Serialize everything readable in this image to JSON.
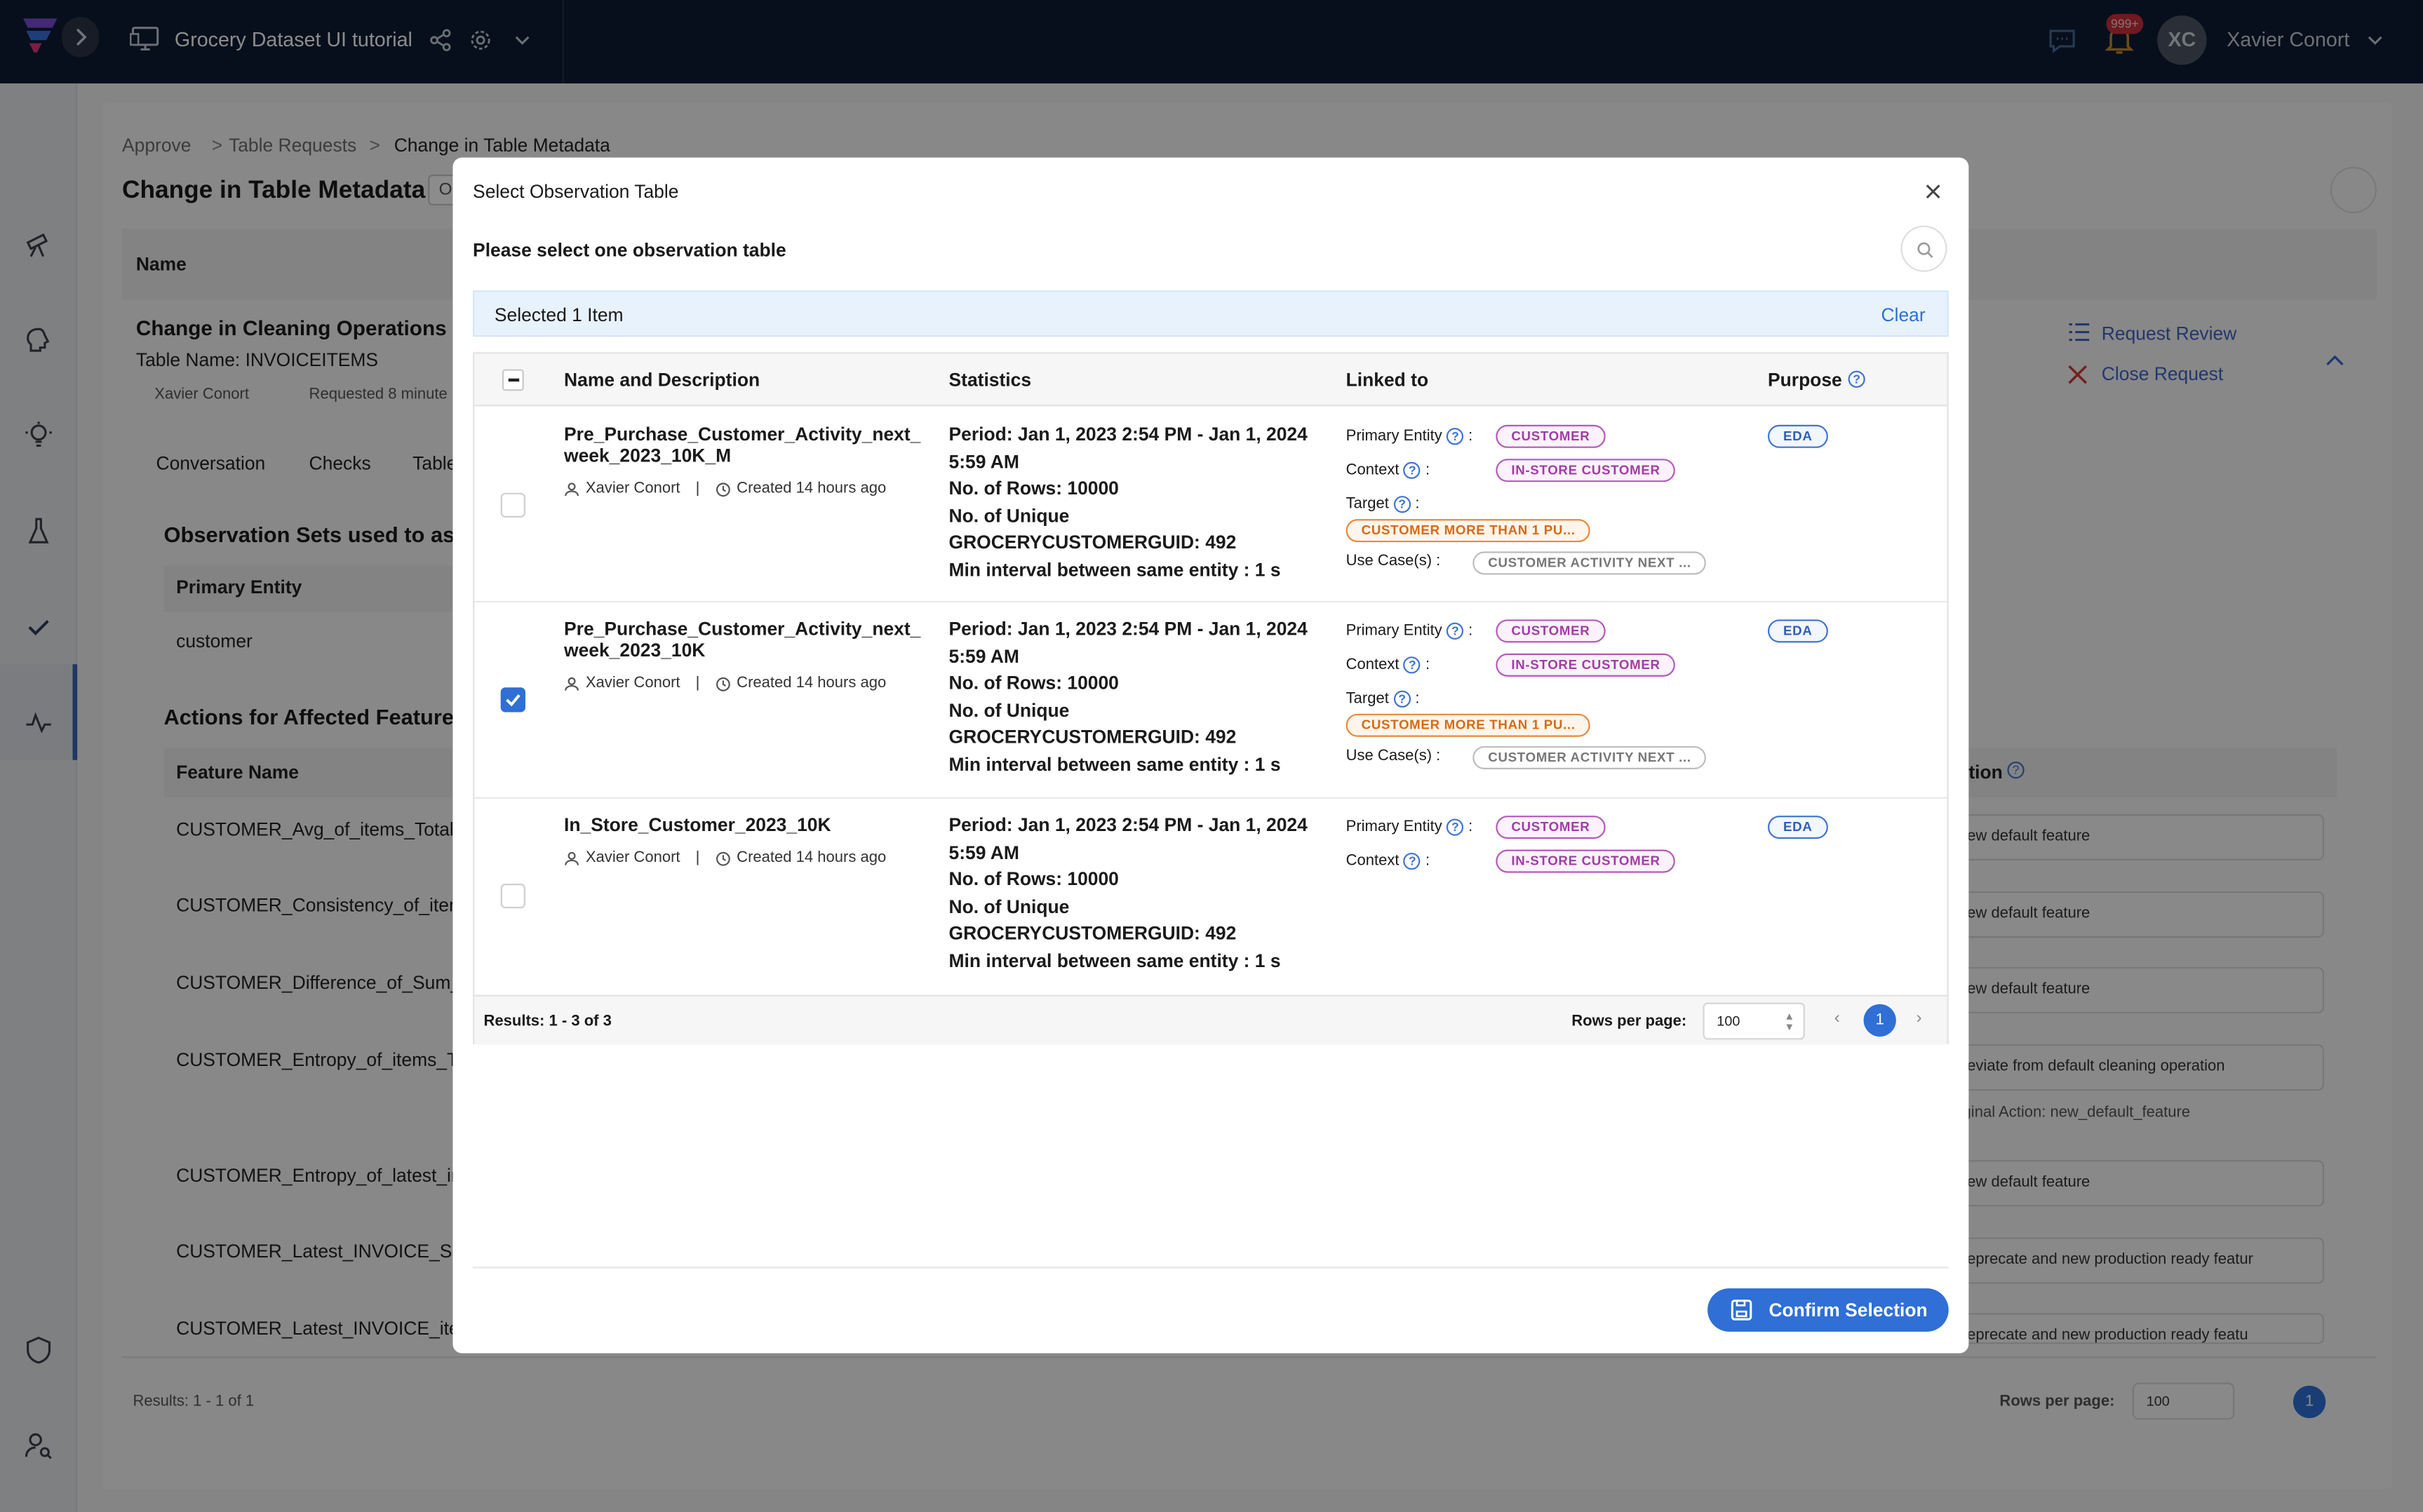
{
  "app": {
    "project_title": "Grocery Dataset UI tutorial",
    "notification_count": "999+",
    "user_initials": "XC",
    "user_name": "Xavier Conort"
  },
  "breadcrumb": [
    "Approve",
    ">",
    "Table Requests",
    ">",
    "Change in Table Metadata"
  ],
  "page": {
    "title": "Change in Table Metadata",
    "title_tag": "Op",
    "name_header": "Name",
    "request_title": "Change in Cleaning Operations o",
    "table_name": "Table Name: INVOICEITEMS",
    "requester": "Xavier Conort",
    "requested": "Requested 8 minute",
    "request_review": "Request Review",
    "close_request": "Close Request",
    "tabs": [
      "Conversation",
      "Checks",
      "Table"
    ],
    "obs_sets_heading": "Observation Sets used to asse",
    "primary_entity_header": "Primary Entity",
    "primary_entity_value": "customer",
    "actions_heading": "Actions for Affected Features:",
    "feature_name_header": "Feature Name",
    "action_header": "tion",
    "features": [
      "CUSTOMER_Avg_of_items_TotalC",
      "CUSTOMER_Consistency_of_item",
      "CUSTOMER_Difference_of_Sum_",
      "CUSTOMER_Entropy_of_items_To",
      "CUSTOMER_Entropy_of_latest_in",
      "CUSTOMER_Latest_INVOICE_Sun",
      "CUSTOMER_Latest_INVOICE_iten"
    ],
    "actions": [
      "ew default feature",
      "ew default feature",
      "ew default feature",
      "eviate from default cleaning operation",
      "ew default feature",
      "eprecate and new production ready featur",
      "eprecate and new production ready featu"
    ],
    "original_action": "ginal Action: new_default_feature",
    "results": "Results: 1 - 1 of 1",
    "rows_per_page_label": "Rows per page:",
    "rows_per_page": "100",
    "page": "1"
  },
  "modal": {
    "title": "Select Observation Table",
    "subtitle": "Please select one observation table",
    "selected_text": "Selected 1 Item",
    "clear_label": "Clear",
    "columns": [
      "Name and Description",
      "Statistics",
      "Linked to",
      "Purpose"
    ],
    "rows": [
      {
        "name": "Pre_Purchase_Customer_Activity_next_week_2023_10K_M",
        "author": "Xavier Conort",
        "created": "Created 14 hours ago",
        "checked": false,
        "stats": [
          "Period: Jan 1, 2023 2:54 PM - Jan 1, 2024 5:59 AM",
          "No. of Rows: 10000",
          "No. of Unique GROCERYCUSTOMERGUID: 492",
          "Min interval between same entity : 1 s"
        ],
        "primary_entity": "CUSTOMER",
        "context": "IN-STORE CUSTOMER",
        "target": "CUSTOMER MORE THAN 1 PU...",
        "use_case": "CUSTOMER ACTIVITY NEXT ...",
        "purpose": "EDA"
      },
      {
        "name": "Pre_Purchase_Customer_Activity_next_week_2023_10K",
        "author": "Xavier Conort",
        "created": "Created 14 hours ago",
        "checked": true,
        "stats": [
          "Period: Jan 1, 2023 2:54 PM - Jan 1, 2024 5:59 AM",
          "No. of Rows: 10000",
          "No. of Unique GROCERYCUSTOMERGUID: 492",
          "Min interval between same entity : 1 s"
        ],
        "primary_entity": "CUSTOMER",
        "context": "IN-STORE CUSTOMER",
        "target": "CUSTOMER MORE THAN 1 PU...",
        "use_case": "CUSTOMER ACTIVITY NEXT ...",
        "purpose": "EDA"
      },
      {
        "name": "In_Store_Customer_2023_10K",
        "author": "Xavier Conort",
        "created": "Created 14 hours ago",
        "checked": false,
        "stats": [
          "Period: Jan 1, 2023 2:54 PM - Jan 1, 2024 5:59 AM",
          "No. of Rows: 10000",
          "No. of Unique GROCERYCUSTOMERGUID: 492",
          "Min interval between same entity : 1 s"
        ],
        "primary_entity": "CUSTOMER",
        "context": "IN-STORE CUSTOMER",
        "purpose": "EDA"
      }
    ],
    "labels": {
      "primary_entity": "Primary Entity",
      "context": "Context",
      "target": "Target",
      "use_cases": "Use Case(s) :",
      "colon": ":"
    },
    "results": "Results: 1 - 3 of 3",
    "rows_per_page_label": "Rows per page:",
    "rows_per_page": "100",
    "page": "1",
    "confirm_label": "Confirm Selection"
  },
  "colors": {
    "topbar": "#0e1c33",
    "accent": "#2f6fd6",
    "entity_tag": "#a13ca6",
    "target_tag": "#d66a12"
  }
}
